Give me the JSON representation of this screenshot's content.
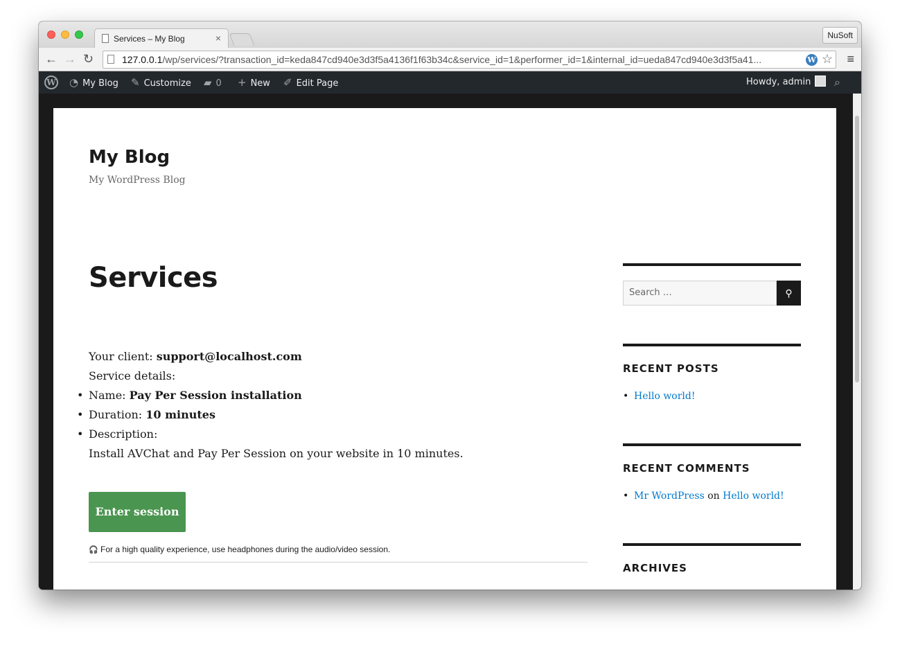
{
  "browser": {
    "tab_title": "Services – My Blog",
    "tab_close": "×",
    "profile": "NuSoft",
    "url_host": "127.0.0.1",
    "url_rest": "/wp/services/?transaction_id=keda847cd940e3d3f5a4136f1f63b34c&service_id=1&performer_id=1&internal_id=ueda847cd940e3d3f5a41...",
    "nav_back": "←",
    "nav_forward": "→",
    "nav_reload": "↻",
    "star": "☆",
    "menu": "≡",
    "wp_ext": "W"
  },
  "adminbar": {
    "wp_logo": "W",
    "site_name": "My Blog",
    "customize": "Customize",
    "comments_count": "0",
    "new": "New",
    "edit_page": "Edit Page",
    "howdy": "Howdy, admin",
    "search_icon": "⌕"
  },
  "site": {
    "title": "My Blog",
    "description": "My WordPress Blog"
  },
  "page": {
    "title": "Services",
    "client_label": "Your client: ",
    "client_value": "support@localhost.com",
    "details_label": "Service details:",
    "name_label": "Name: ",
    "name_value": "Pay Per Session installation",
    "duration_label": "Duration: ",
    "duration_value": "10 minutes",
    "description_label": "Description:",
    "description_value": "Install AVChat and Pay Per Session on your website in 10 minutes.",
    "enter_button": "Enter session",
    "hint_icon": "🎧",
    "hint": "For a high quality experience, use headphones during the audio/video session."
  },
  "sidebar": {
    "search_placeholder": "Search …",
    "search_icon": "⚲",
    "recent_posts_title": "RECENT POSTS",
    "recent_posts": [
      "Hello world!"
    ],
    "recent_comments_title": "RECENT COMMENTS",
    "comment_author": "Mr WordPress",
    "comment_on": " on ",
    "comment_post": "Hello world!",
    "archives_title": "ARCHIVES"
  }
}
